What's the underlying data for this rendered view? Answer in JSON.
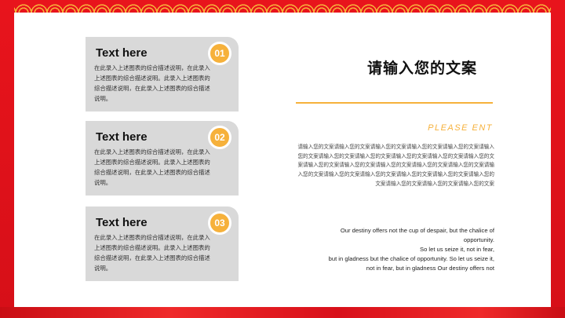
{
  "items": [
    {
      "title": "Text here",
      "number": "01",
      "body": "在此录入上述图表的综合描述说明，在此录入上述图表的综合描述说明。此录入上述图表的综合描述说明，在此录入上述图表的综合描述说明。"
    },
    {
      "title": "Text here",
      "number": "02",
      "body": "在此录入上述图表的综合描述说明，在此录入上述图表的综合描述说明。此录入上述图表的综合描述说明，在此录入上述图表的综合描述说明。"
    },
    {
      "title": "Text here",
      "number": "03",
      "body": "在此录入上述图表的综合描述说明，在此录入上述图表的综合描述说明。此录入上述图表的综合描述说明，在此录入上述图表的综合描述说明。"
    }
  ],
  "right": {
    "heading": "请输入您的文案",
    "subtitle": "PLEASE ENT",
    "paragraph": "请输入您的文案请输入您的文案请输入您的文案请输入您的文案请输入您的文案请输入您的文案请输入您的文案请输入您的文案请输入您的文案请输入您的文案请输入您的文案请输入您的文案请输入您的文案请输入您的文案请输入您的文案请输入您的文案请输入您的文案请输入您的文案请输入您的文案请输入您的文案请输入您的文案请输入您的文案请输入您的文案请输入您的文案请输入您的文案",
    "quote_lines": [
      "Our destiny offers not the cup of despair, but the chalice of",
      "opportunity.",
      "So let us seize it, not in fear,",
      "but in gladness but the chalice of opportunity. So let us seize it,",
      "not in fear, but in gladness Our destiny offers not"
    ]
  },
  "colors": {
    "accent": "#f6b13b",
    "frame": "#e8141c",
    "card": "#d9d9d9"
  }
}
